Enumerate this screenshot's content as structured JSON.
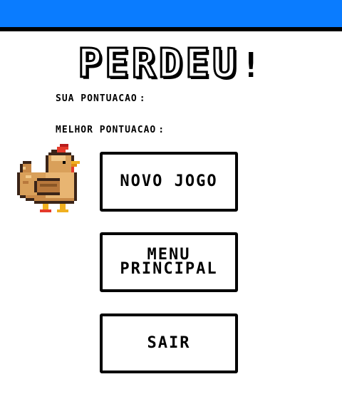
{
  "screen": {
    "title": "PERDEU",
    "title_suffix": "!",
    "top_bar_color": "#0a7cff"
  },
  "stats": {
    "current_label": "SUA PONTUACAO",
    "current_colon": ":",
    "current_value": "",
    "best_label": "MELHOR PONTUACAO",
    "best_colon": ":",
    "best_value": ""
  },
  "character": {
    "icon": "chicken-sprite-icon"
  },
  "buttons": {
    "new_game": "NOVO JOGO",
    "main_menu": "MENU\nPRINCIPAL",
    "exit": "SAIR"
  }
}
